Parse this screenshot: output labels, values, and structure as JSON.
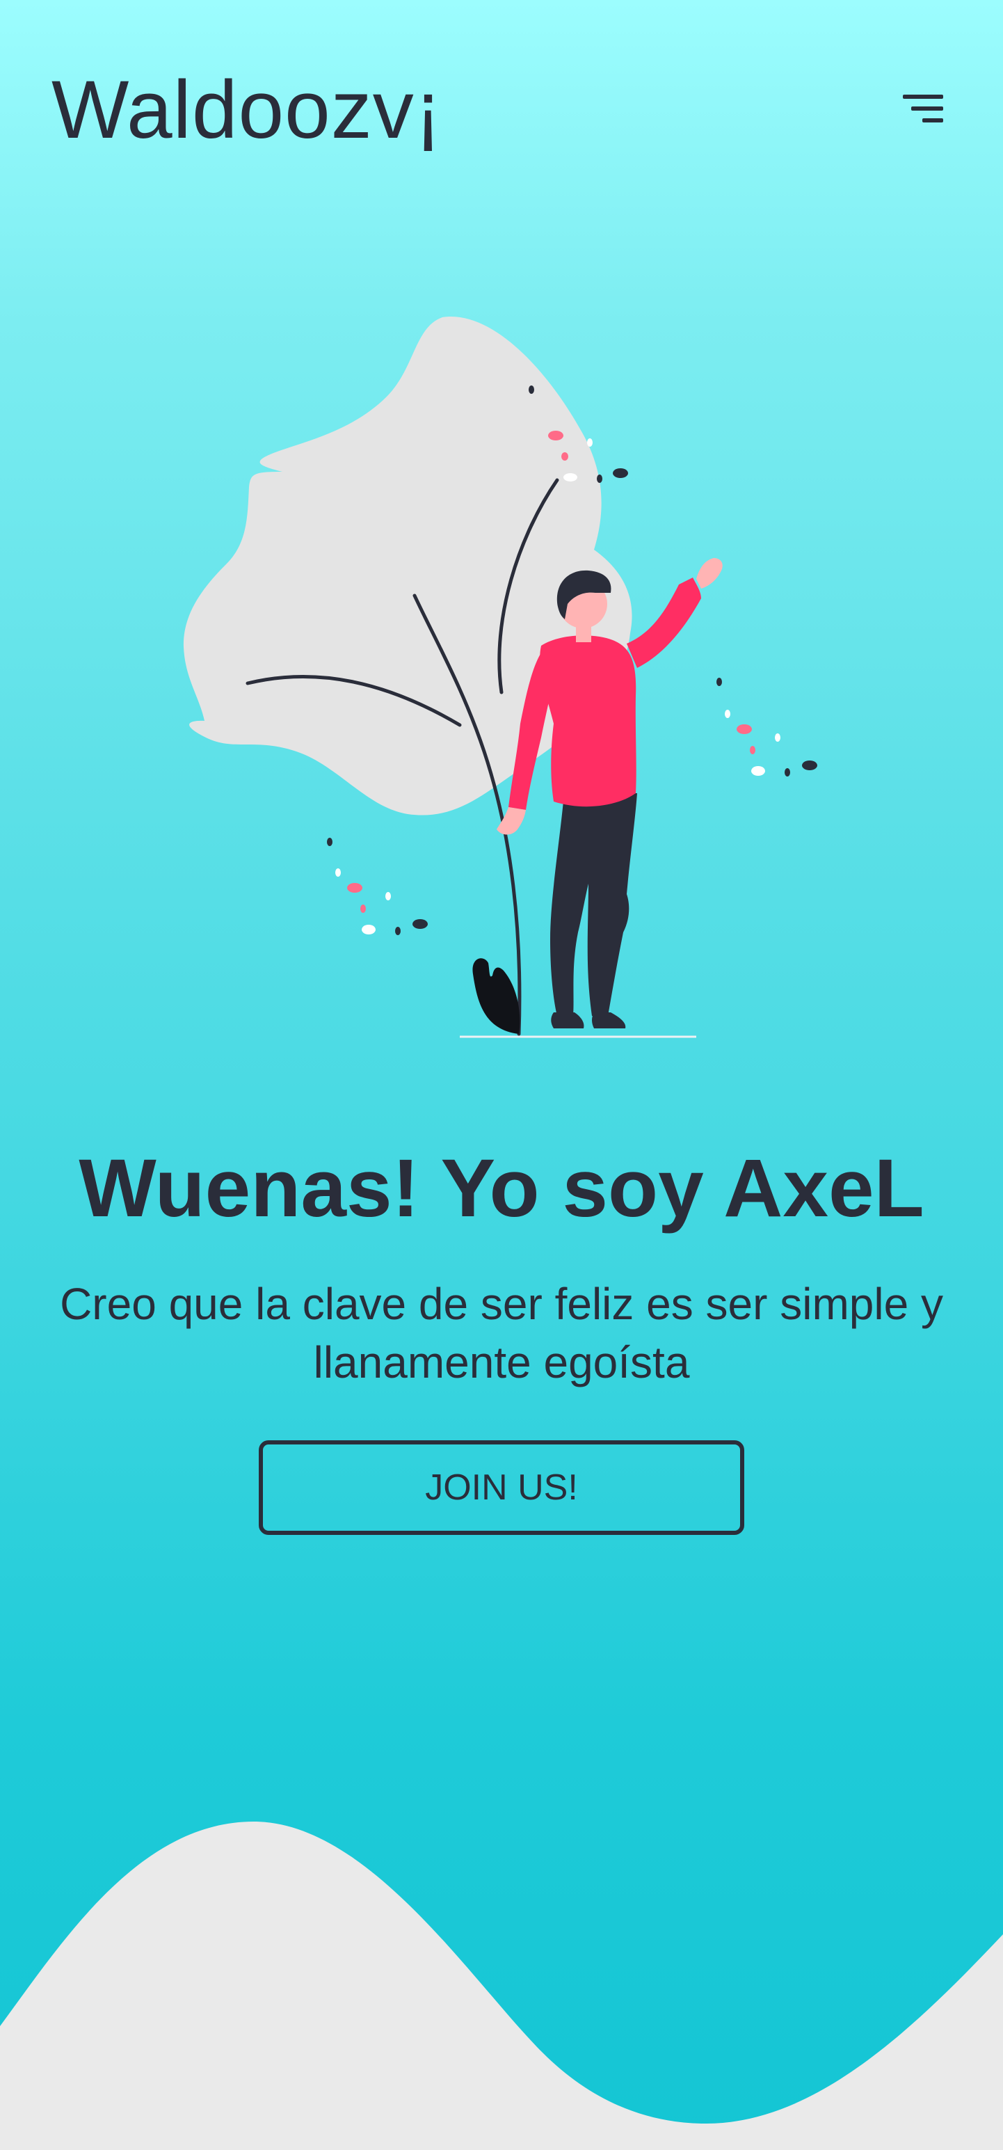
{
  "header": {
    "logo_text": "Waldoozv¡",
    "menu_icon": "hamburger-menu-icon"
  },
  "hero": {
    "title": "Wuenas! Yo soy AxeL",
    "subtitle": "Creo que la clave de ser feliz es ser simple y llanamente egoísta",
    "cta_label": "JOIN US!"
  },
  "colors": {
    "background_top": "#9cfdfe",
    "background_bottom": "#14c5d4",
    "text": "#2a2d3a",
    "accent": "#ff2e63",
    "wave": "#eaeaea"
  }
}
